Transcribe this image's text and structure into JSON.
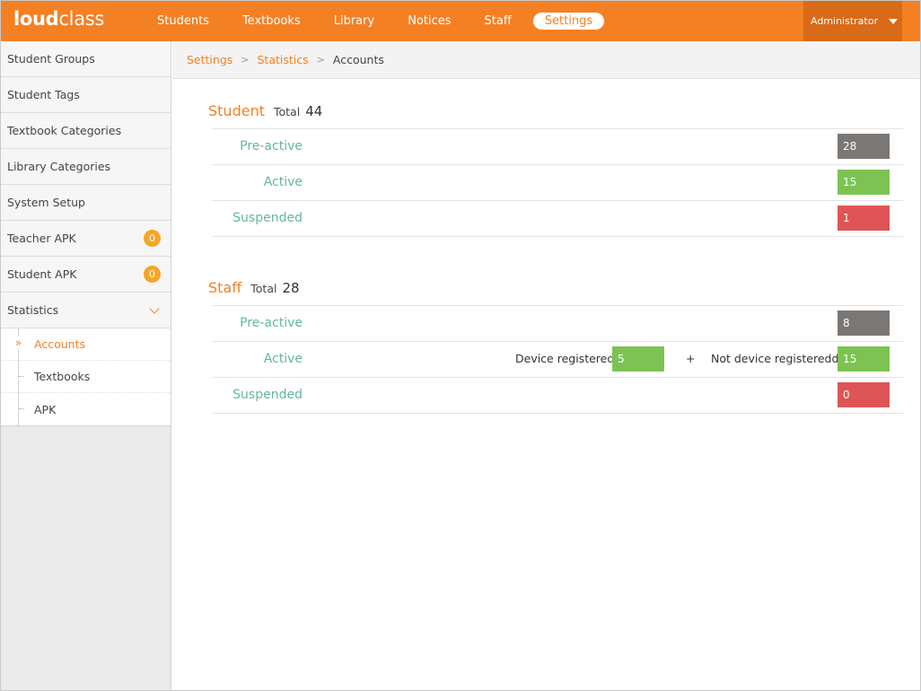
{
  "app": {
    "logo_bold": "loud",
    "logo_light": "class"
  },
  "topnav": {
    "items": [
      {
        "label": "Students"
      },
      {
        "label": "Textbooks"
      },
      {
        "label": "Library"
      },
      {
        "label": "Notices"
      },
      {
        "label": "Staff"
      },
      {
        "label": "Settings",
        "active": true
      }
    ],
    "user": "Administrator"
  },
  "sidebar": {
    "items": [
      {
        "label": "Student Groups"
      },
      {
        "label": "Student Tags"
      },
      {
        "label": "Textbook Categories"
      },
      {
        "label": "Library Categories"
      },
      {
        "label": "System Setup"
      },
      {
        "label": "Teacher APK",
        "badge": "0"
      },
      {
        "label": "Student APK",
        "badge": "0"
      },
      {
        "label": "Statistics",
        "expanded": true
      }
    ],
    "sub_items": [
      {
        "label": "Accounts",
        "active": true
      },
      {
        "label": "Textbooks"
      },
      {
        "label": "APK"
      }
    ]
  },
  "breadcrumb": {
    "items": [
      "Settings",
      "Statistics"
    ],
    "current": "Accounts"
  },
  "student": {
    "title": "Student",
    "total_label": "Total",
    "total": "44",
    "rows": [
      {
        "label": "Pre-active",
        "value": "28"
      },
      {
        "label": "Active",
        "value": "15"
      },
      {
        "label": "Suspended",
        "value": "1"
      }
    ]
  },
  "staff": {
    "title": "Staff",
    "total_label": "Total",
    "total": "28",
    "rows": [
      {
        "label": "Pre-active",
        "value": "8"
      },
      {
        "label": "Active",
        "device_label": "Device registered",
        "device_value": "5",
        "plus": "+",
        "not_device_label": "Not device registeredd",
        "value": "15"
      },
      {
        "label": "Suspended",
        "value": "0"
      }
    ]
  },
  "colors": {
    "accent": "#f48024",
    "pre_active": "#7a7775",
    "active": "#7cc353",
    "suspended": "#df5456",
    "row_label": "#62b7a4"
  }
}
